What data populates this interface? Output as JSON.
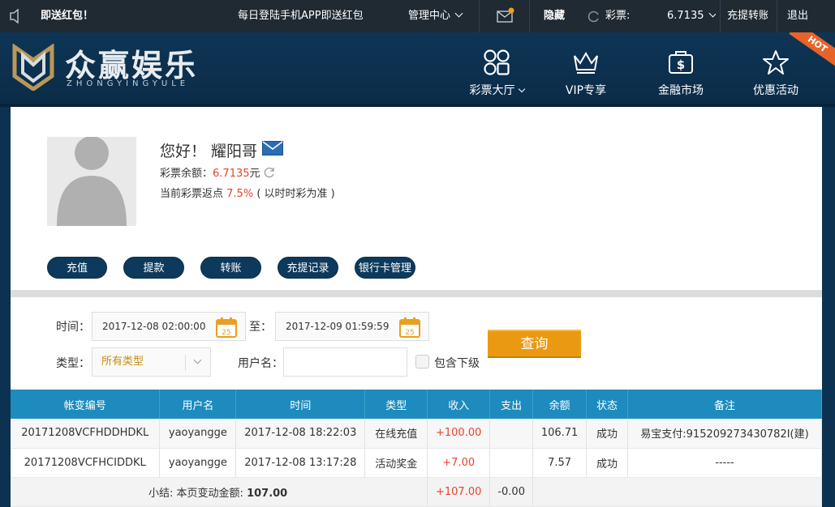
{
  "topbar": {
    "marquee_left": "即送红包！",
    "marquee_right": "每日登陆手机APP即送红包",
    "management": "管理中心",
    "hide": "隐藏",
    "lottery_label": "彩票:",
    "lottery_value": "6.7135",
    "recharge_transfer": "充提转账",
    "logout": "退出"
  },
  "header": {
    "brand_title": "众赢娱乐",
    "brand_sub": "ZHONGYINGYULE",
    "nav": [
      {
        "label": "彩票大厅",
        "icon": "grid-icon"
      },
      {
        "label": "VIP专享",
        "icon": "crown-icon"
      },
      {
        "label": "金融市场",
        "icon": "money-bag-icon"
      },
      {
        "label": "优惠活动",
        "icon": "star-icon"
      }
    ],
    "hot_badge": "HOT"
  },
  "profile": {
    "greeting": "您好！ 耀阳哥",
    "balance_label": "彩票余额：",
    "balance_value": "6.7135",
    "balance_unit": "元",
    "rebate_label": "当前彩票返点",
    "rebate_value": "7.5%",
    "rebate_note": "( 以时时彩为准 )"
  },
  "actions": [
    "充值",
    "提款",
    "转账",
    "充提记录",
    "银行卡管理"
  ],
  "filter": {
    "time_label": "时间：",
    "start": "2017-12-08 02:00:00",
    "to_label": "至：",
    "end": "2017-12-09 01:59:59",
    "calendar_day": "25",
    "type_label": "类型：",
    "type_value": "所有类型",
    "username_label": "用户名：",
    "username_value": "",
    "include_sub": "包含下级",
    "query": "查询"
  },
  "table": {
    "headers": [
      "帐变编号",
      "用户名",
      "时间",
      "类型",
      "收入",
      "支出",
      "余额",
      "状态",
      "备注"
    ],
    "rows": [
      {
        "id": "20171208VCFHDDHDKL",
        "user": "yaoyangge",
        "time": "2017-12-08 18:22:03",
        "type": "在线充值",
        "income": "+100.00",
        "expense": "",
        "balance": "106.71",
        "status": "成功",
        "note": "易宝支付:915209273430782I(建)"
      },
      {
        "id": "20171208VCFHCIDDKL",
        "user": "yaoyangge",
        "time": "2017-12-08 13:17:28",
        "type": "活动奖金",
        "income": "+7.00",
        "expense": "",
        "balance": "7.57",
        "status": "成功",
        "note": "-----"
      }
    ],
    "summary_label": "小结: 本页变动金额:",
    "summary_amount": "107.00",
    "summary_income": "+107.00",
    "summary_expense": "-0.00"
  },
  "colors": {
    "header_bg": "#0e3556",
    "topbar_bg": "#1f2a33",
    "accent_red": "#e8422b",
    "query_orange": "#e99a12",
    "table_head": "#1d8bbd"
  }
}
